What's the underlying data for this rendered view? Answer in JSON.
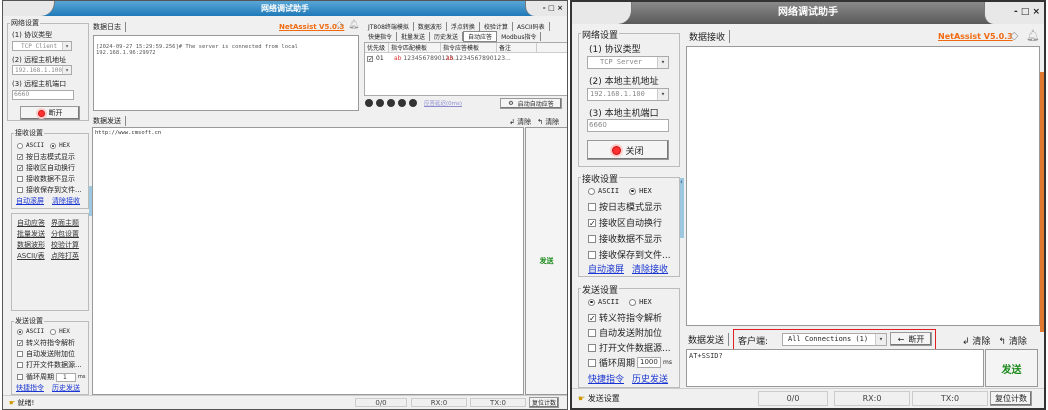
{
  "left_window": {
    "title": "网络调试助手",
    "brand": "NetAssist V5.0.3",
    "network": {
      "group": "网络设置",
      "protocol_label": "(1) 协议类型",
      "protocol": "TCP Client",
      "host_label": "(2) 远程主机地址",
      "host": "192.168.1.100",
      "port_label": "(3) 远程主机端口",
      "port": "6660",
      "connect_button": "断开"
    },
    "receive": {
      "group": "接收设置",
      "ascii": "ASCII",
      "hex": "HEX",
      "mode": "HEX",
      "options": [
        {
          "label": "按日志模式显示",
          "checked": true
        },
        {
          "label": "接收区自动换行",
          "checked": true
        },
        {
          "label": "接收数据不显示",
          "checked": false
        },
        {
          "label": "接收保存到文件...",
          "checked": false
        }
      ],
      "links": [
        "自动滚屏",
        "清除接收"
      ]
    },
    "tools": [
      [
        "自动应答",
        "界面主题"
      ],
      [
        "批量发送",
        "分包设置"
      ],
      [
        "数据波形",
        "校验计算"
      ],
      [
        "ASCII/表",
        "点阵打英"
      ]
    ],
    "send": {
      "group": "发送设置",
      "ascii": "ASCII",
      "hex": "HEX",
      "mode": "ASCII",
      "options": [
        {
          "label": "转义符指令解析",
          "checked": true
        },
        {
          "label": "自动发送附加位",
          "checked": false
        },
        {
          "label": "打开文件数据源...",
          "checked": false
        }
      ],
      "cycle_label": "循环周期",
      "cycle_value": "1",
      "cycle_unit": "ms",
      "links": [
        "快捷指令",
        "历史发送"
      ]
    },
    "log_tab": "数据日志",
    "log_text": "[2024-09-27 15:29:59.256]# The server is connected from local\n192.168.1.96:29972",
    "right_tabs_row1": [
      "JT808终端模拟",
      "数据波形",
      "浮点转换",
      "校验计算",
      "ASCII码表"
    ],
    "right_tabs_row2": [
      "快捷指令",
      "批量发送",
      "历史发送",
      "自动应答",
      "Modbus指令"
    ],
    "active_tab": "自动应答",
    "table": {
      "headers": [
        "优先级",
        "指令匹配模板",
        "指令应答模板",
        "备注"
      ],
      "rows": [
        {
          "checked": true,
          "priority": "01",
          "match": "1234567890123...",
          "reply": "1234567890123...",
          "note": ""
        }
      ]
    },
    "reply_delay": "应答延迟(0ms)",
    "start_auto_reply": "启动自动应答",
    "send_tab": "数据发送",
    "clear1": "清除",
    "clear2": "清除",
    "send_text": "http://www.cmsoft.cn",
    "send_button": "发送",
    "status": {
      "message": "就绪!",
      "count": "0/0",
      "rx": "RX:0",
      "tx": "TX:0",
      "reset": "复位计数"
    }
  },
  "right_window": {
    "title": "网络调试助手",
    "brand": "NetAssist V5.0.3",
    "network": {
      "group": "网络设置",
      "protocol_label": "(1) 协议类型",
      "protocol": "TCP Server",
      "host_label": "(2) 本地主机地址",
      "host": "192.168.1.100",
      "port_label": "(3) 本地主机端口",
      "port": "6660",
      "connect_button": "关闭"
    },
    "receive": {
      "group": "接收设置",
      "ascii": "ASCII",
      "hex": "HEX",
      "mode": "HEX",
      "options": [
        {
          "label": "按日志模式显示",
          "checked": false
        },
        {
          "label": "接收区自动换行",
          "checked": true
        },
        {
          "label": "接收数据不显示",
          "checked": false
        },
        {
          "label": "接收保存到文件...",
          "checked": false
        }
      ],
      "links": [
        "自动滚屏",
        "清除接收"
      ]
    },
    "send": {
      "group": "发送设置",
      "ascii": "ASCII",
      "hex": "HEX",
      "mode": "ASCII",
      "options": [
        {
          "label": "转义符指令解析",
          "checked": true
        },
        {
          "label": "自动发送附加位",
          "checked": false
        },
        {
          "label": "打开文件数据源...",
          "checked": false
        }
      ],
      "cycle_label": "循环周期",
      "cycle_value": "1000",
      "cycle_unit": "ms",
      "links": [
        "快捷指令",
        "历史发送"
      ]
    },
    "receive_tab": "数据接收",
    "send_tab": "数据发送",
    "client_label": "客户端:",
    "client_select": "All Connections (1)",
    "disconnect_button": "断开",
    "clear1": "清除",
    "clear2": "清除",
    "send_text": "AT+SSID?",
    "send_button": "发送",
    "highlight_color": "#e02020",
    "status": {
      "message": "发送设置",
      "count": "0/0",
      "rx": "RX:0",
      "tx": "TX:0",
      "reset": "复位计数"
    }
  }
}
